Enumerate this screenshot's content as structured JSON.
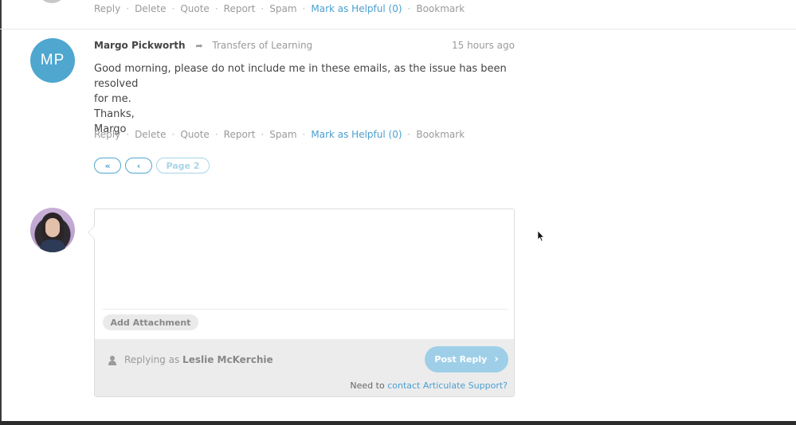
{
  "previous_post": {
    "actions": [
      "Reply",
      "Delete",
      "Quote",
      "Report",
      "Spam",
      "Mark as Helpful (0)",
      "Bookmark"
    ]
  },
  "post": {
    "avatar_initials": "MP",
    "author": "Margo Pickworth",
    "thread": "Transfers of Learning",
    "timestamp": "15 hours ago",
    "body_line1": "Good morning, please do not include me in these emails, as the issue has been resolved",
    "body_line2": "for me.",
    "body_line3": "Thanks,",
    "body_line4": "Margo",
    "actions": [
      "Reply",
      "Delete",
      "Quote",
      "Report",
      "Spam",
      "Mark as Helpful (0)",
      "Bookmark"
    ]
  },
  "pagination": {
    "first_icon": "«",
    "prev_icon": "‹",
    "page_label": "Page 2"
  },
  "reply": {
    "add_attachment": "Add Attachment",
    "replying_prefix": "Replying as",
    "replying_user": "Leslie McKerchie",
    "post_button": "Post Reply",
    "support_prefix": "Need to",
    "support_link": "contact Articulate Support?"
  },
  "colors": {
    "accent": "#4fa7cf",
    "post_button": "#9fcfe8",
    "footer_bg": "#ececec"
  }
}
